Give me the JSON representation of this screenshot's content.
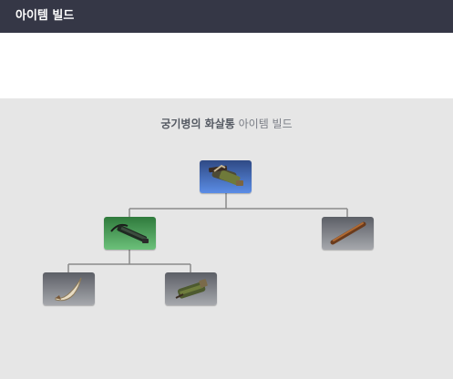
{
  "header": {
    "title": "아이템 빌드"
  },
  "tree": {
    "title_item": "궁기병의 화살통",
    "title_suffix": " 아이템 빌드",
    "nodes": [
      {
        "id": "root",
        "tier": "blue",
        "icon": "quiver-crossbow-icon"
      },
      {
        "id": "mid-left",
        "tier": "green",
        "icon": "crossbow-quiver-icon"
      },
      {
        "id": "mid-right",
        "tier": "grey",
        "icon": "wooden-stick-icon"
      },
      {
        "id": "leaf-left",
        "tier": "grey",
        "icon": "horn-icon"
      },
      {
        "id": "leaf-right",
        "tier": "grey",
        "icon": "quiver-icon"
      }
    ]
  }
}
